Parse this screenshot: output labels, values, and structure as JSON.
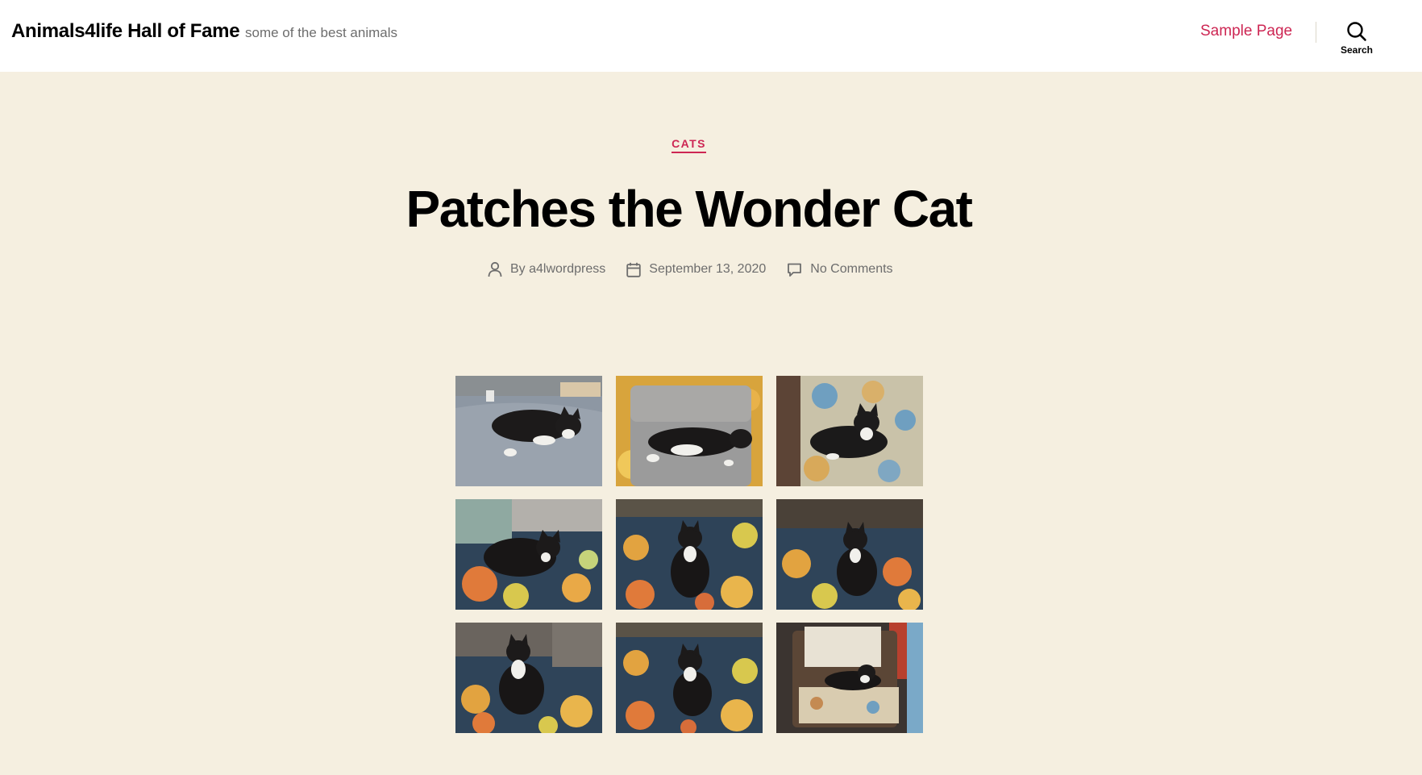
{
  "header": {
    "site_title": "Animals4life Hall of Fame",
    "site_description": "some of the best animals",
    "nav": [
      {
        "label": "Sample Page"
      }
    ],
    "search_label": "Search"
  },
  "post": {
    "category": "CATS",
    "title": "Patches the Wonder Cat",
    "author_prefix": "By",
    "author": "a4lwordpress",
    "date": "September 13, 2020",
    "comments": "No Comments"
  },
  "gallery": {
    "photos": [
      {
        "subject": "black-and-white cat lying on gray ottoman"
      },
      {
        "subject": "black-and-white cat stretched on gray ottoman"
      },
      {
        "subject": "black-and-white cat resting on floral armchair"
      },
      {
        "subject": "black-and-white cat sitting on floral rug"
      },
      {
        "subject": "black-and-white cat sitting on floral rug"
      },
      {
        "subject": "black-and-white cat sitting on floral rug"
      },
      {
        "subject": "black-and-white cat sitting on floral rug"
      },
      {
        "subject": "black-and-white cat sitting on floral rug"
      },
      {
        "subject": "black-and-white cat lying in floral armchair"
      }
    ]
  },
  "colors": {
    "accent": "#cd2653",
    "background": "#f5efe0",
    "header_background": "#ffffff",
    "meta_text": "#6d6d6d"
  }
}
